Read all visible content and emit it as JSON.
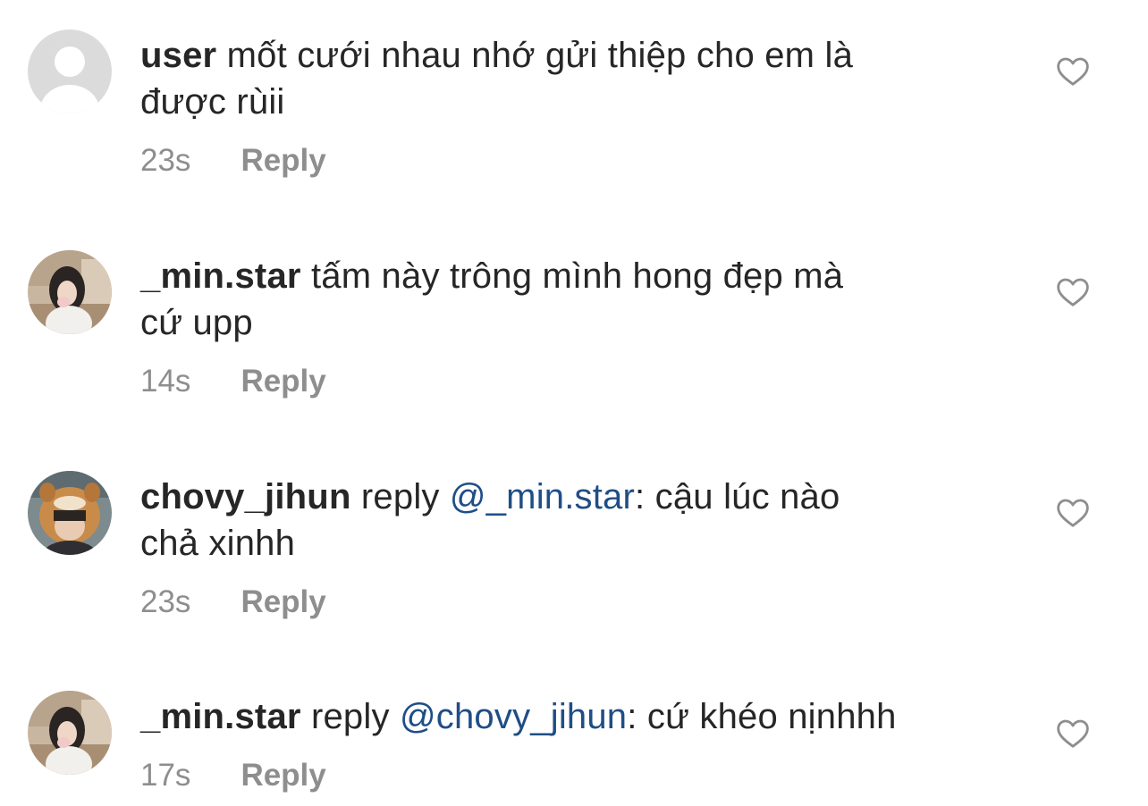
{
  "comments": [
    {
      "avatar": "default-avatar",
      "username": "user",
      "text_before": " mốt cưới nhau nhớ gửi thiệp cho em là",
      "line2": "được rùii",
      "time": "23s",
      "reply_label": "Reply",
      "like_icon": "heart-outline-icon"
    },
    {
      "avatar": "photo-avatar-girl",
      "username": "_min.star",
      "text_before": " tấm này trông mình hong đẹp mà",
      "line2": "cứ upp",
      "time": "14s",
      "reply_label": "Reply",
      "like_icon": "heart-outline-icon"
    },
    {
      "avatar": "photo-avatar-hood",
      "username": "chovy_jihun",
      "reply_word": " reply ",
      "mention": "@_min.star",
      "text_after": ": cậu lúc nào",
      "line2": "chả xinhh",
      "time": "23s",
      "reply_label": "Reply",
      "like_icon": "heart-outline-icon"
    },
    {
      "avatar": "photo-avatar-girl",
      "username": "_min.star",
      "reply_word": " reply ",
      "mention": "@chovy_jihun",
      "text_after": ": cứ khéo nịnhhh",
      "time": "17s",
      "reply_label": "Reply",
      "like_icon": "heart-outline-icon"
    }
  ],
  "colors": {
    "text": "#262626",
    "meta": "#8e8e8e",
    "mention": "#1f4e86",
    "background": "#ffffff"
  }
}
